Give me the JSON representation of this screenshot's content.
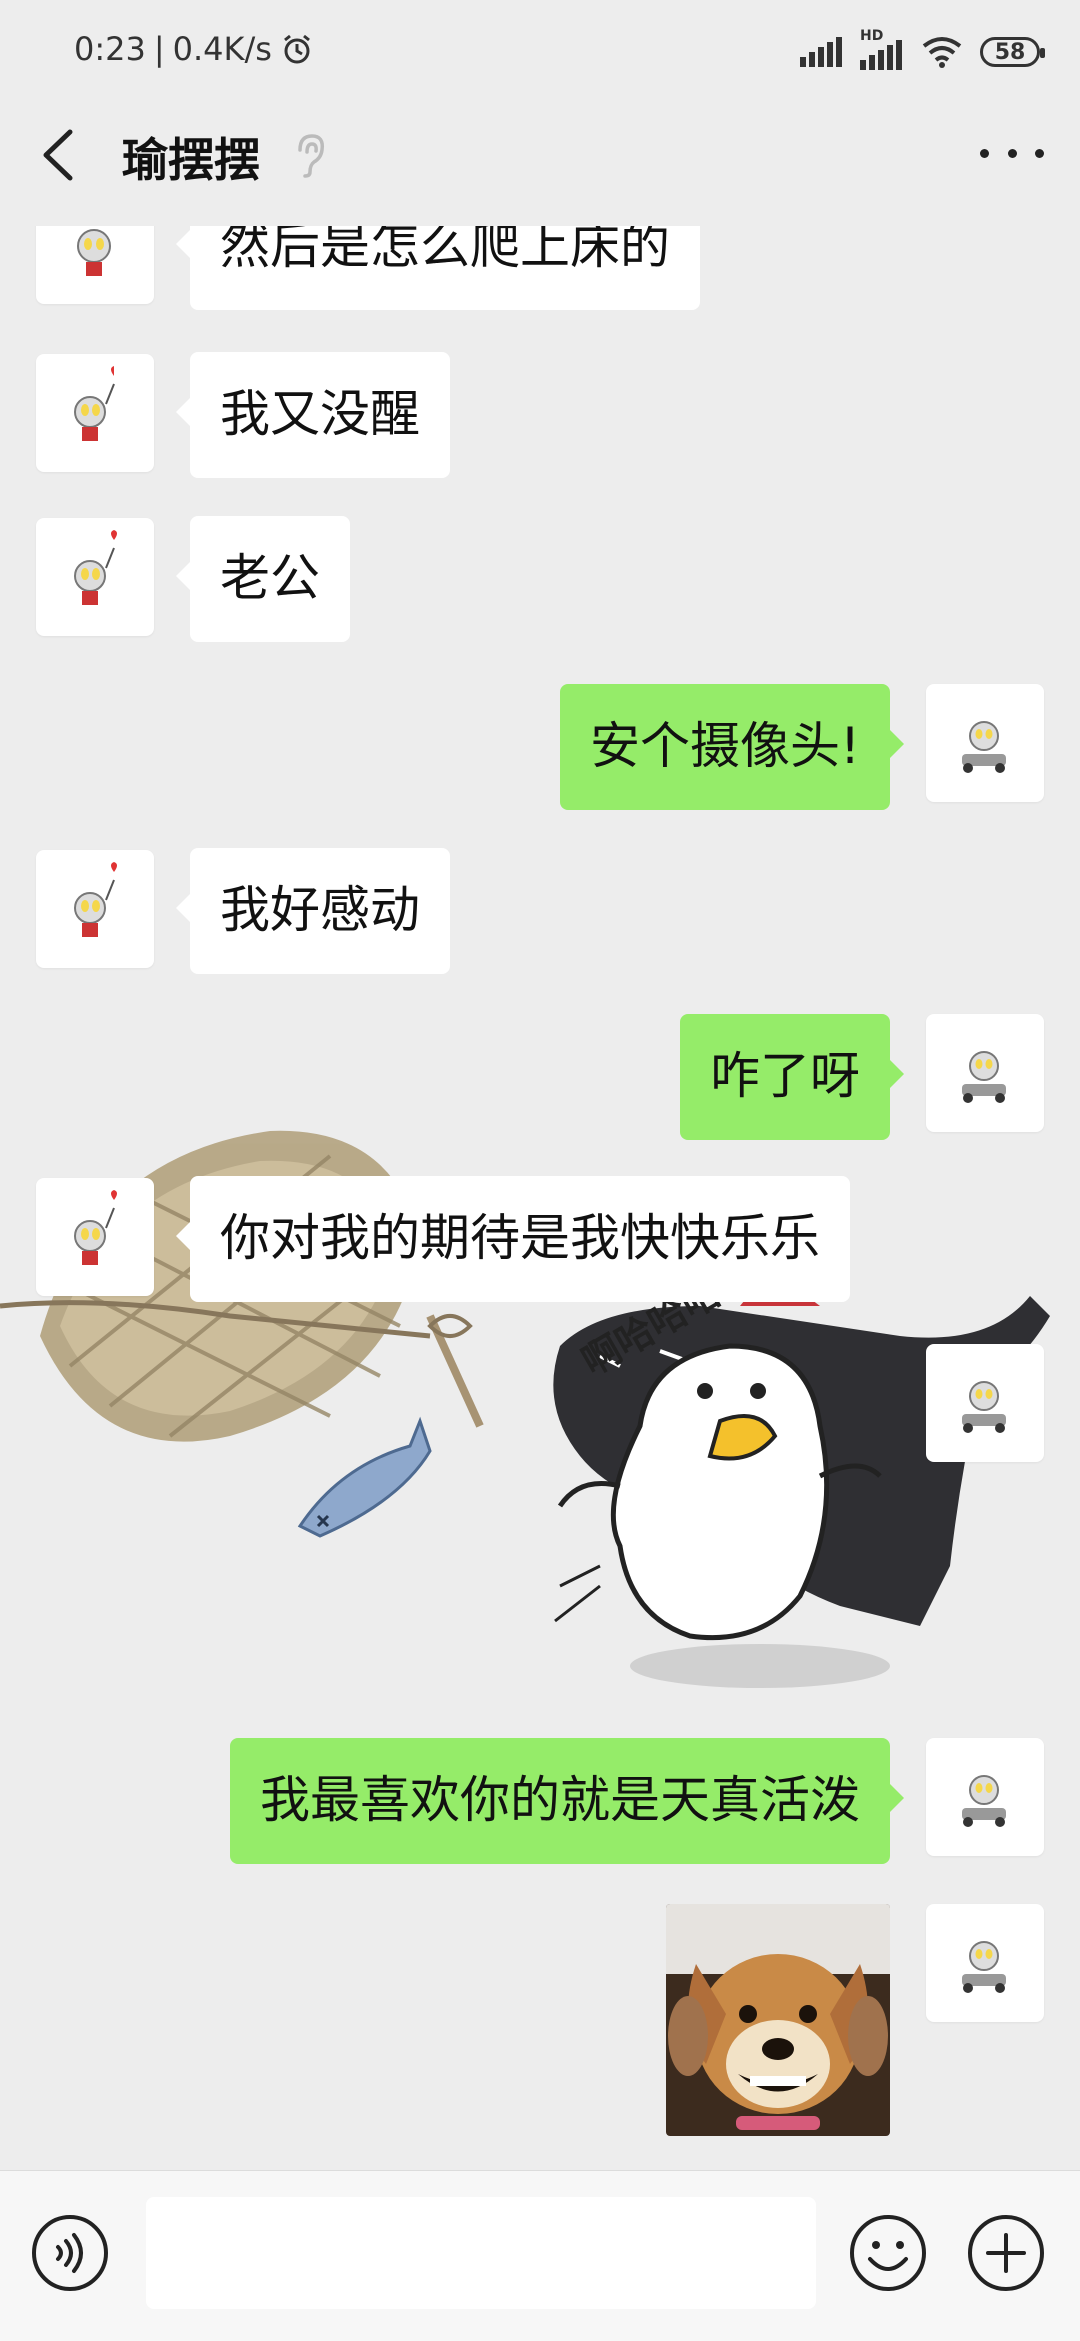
{
  "status_bar": {
    "time": "0:23",
    "separator": "|",
    "net_speed": "0.4K/s",
    "hd_label": "HD",
    "battery": "58"
  },
  "header": {
    "title": "瑜摆摆"
  },
  "messages": [
    {
      "side": "left",
      "text": "然后是怎么爬上床的"
    },
    {
      "side": "left",
      "text": "我又没醒"
    },
    {
      "side": "left",
      "text": "老公"
    },
    {
      "side": "right",
      "text": "安个摄像头!"
    },
    {
      "side": "left",
      "text": "我好感动"
    },
    {
      "side": "right",
      "text": "咋了呀"
    },
    {
      "side": "left",
      "text": "你对我的期待是我快快乐乐"
    },
    {
      "side": "right",
      "type": "sticker",
      "text": "啊哈哈哈哈哈"
    },
    {
      "side": "right",
      "text": "我最喜欢你的就是天真活泼"
    },
    {
      "side": "right",
      "type": "image",
      "icon": "dog-photo"
    }
  ],
  "input": {
    "placeholder": ""
  },
  "colors": {
    "background": "#ededed",
    "sent_bubble": "#95ec69",
    "received_bubble": "#ffffff"
  }
}
